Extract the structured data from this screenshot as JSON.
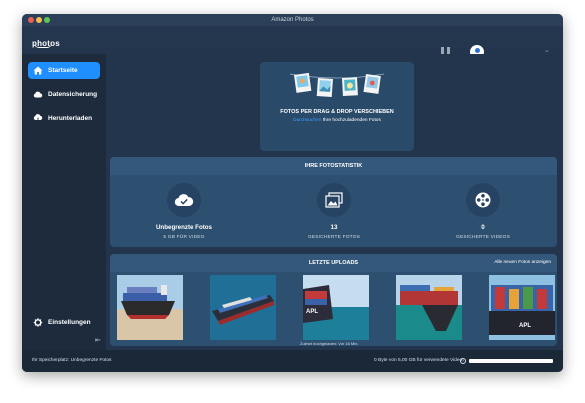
{
  "window": {
    "title": "Amazon Photos"
  },
  "topbar": {
    "logo_text": "photos"
  },
  "sidebar": {
    "items": [
      {
        "label": "Startseite",
        "icon": "home-icon",
        "active": true
      },
      {
        "label": "Datensicherung",
        "icon": "cloud-icon",
        "active": false
      },
      {
        "label": "Herunterladen",
        "icon": "cloud-download-icon",
        "active": false
      }
    ],
    "settings_label": "Einstellungen",
    "collapse_glyph": "⇤"
  },
  "dropzone": {
    "title": "FOTOS PER DRAG & DROP VERSCHIEBEN",
    "link": "Durchsuchen",
    "subtitle_rest": " Ihre hochzuladenden Fotos"
  },
  "stats": {
    "heading": "IHRE FOTOSTATISTIK",
    "items": [
      {
        "value": "Unbegrenzte Fotos",
        "label": "5 GB FÜR VIDEO",
        "icon": "cloud-check-icon"
      },
      {
        "value": "13",
        "label": "GESICHERTE FOTOS",
        "icon": "photos-icon"
      },
      {
        "value": "0",
        "label": "GESICHERTE VIDEOS",
        "icon": "film-reel-icon"
      }
    ]
  },
  "uploads": {
    "heading": "LETZTE UPLOADS",
    "see_all": "Alle neuen Fotos anzeigen",
    "last_uploaded": "Zuletzt hochgeladen: Vor 16 Min.",
    "thumbnails": [
      "container-ship-1",
      "container-ship-2",
      "container-ship-3",
      "container-ship-4",
      "container-ship-5"
    ]
  },
  "status": {
    "left": "Ihr Speicherplatz: Unbegrenzte Fotos",
    "right": "0 Byte von 5,00 GB für verwendete Video",
    "info_glyph": "?",
    "storage_used_fraction": 0.0
  },
  "colors": {
    "accent": "#1f8fff",
    "sidebar_bg": "#1d2b3d",
    "main_bg": "#22354c",
    "card_bg": "#2d4f70",
    "card_head_bg": "#34587b"
  }
}
